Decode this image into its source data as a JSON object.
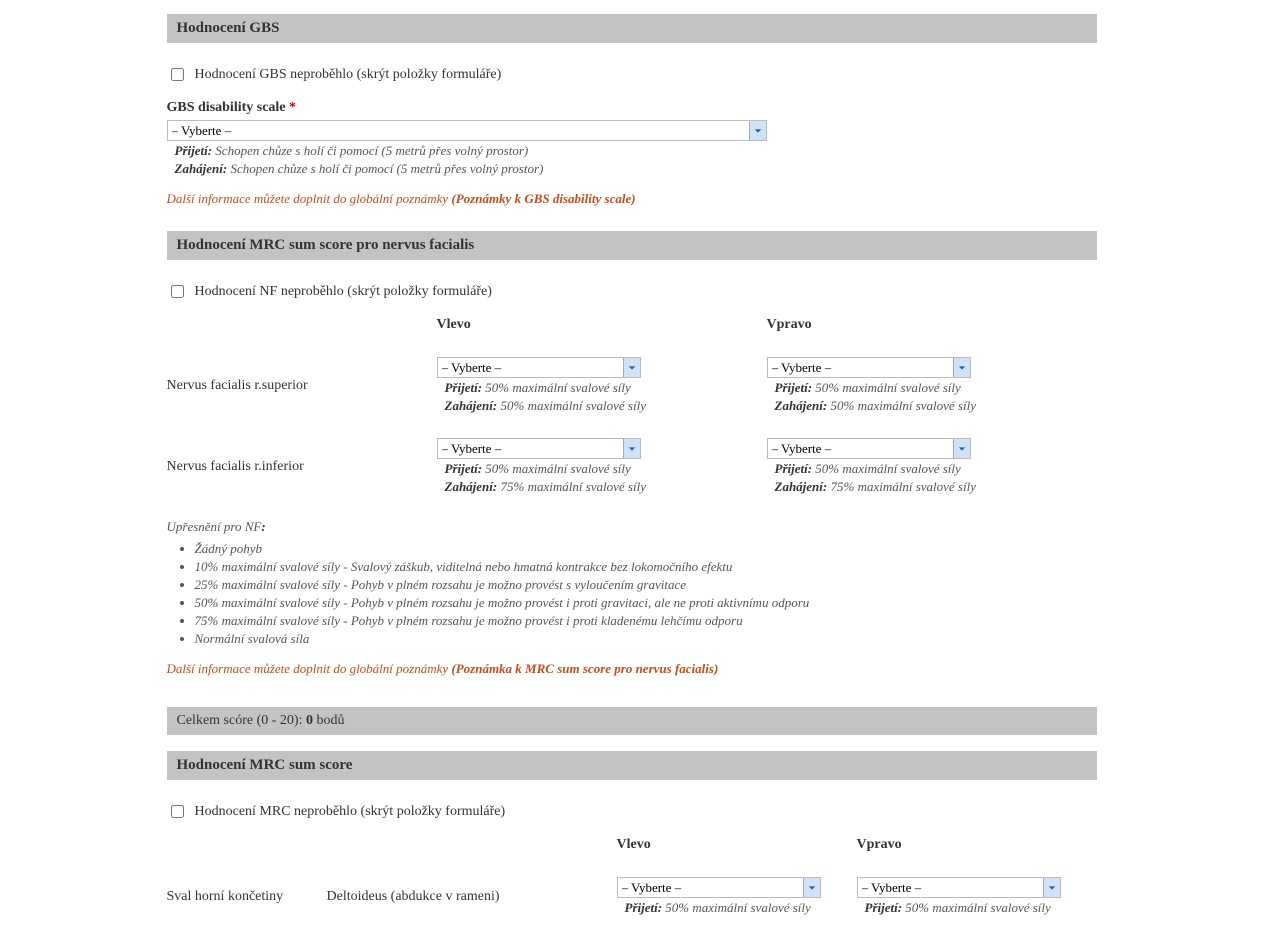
{
  "select_placeholder": "– Vyberte –",
  "hints": {
    "prijeti_label": "Přijetí:",
    "zahajeni_label": "Zahájení:"
  },
  "gbs": {
    "header": "Hodnocení GBS",
    "skip_label": "Hodnocení GBS neproběhlo (skrýt položky formuláře)",
    "scale_label": "GBS disability scale",
    "hint_prijeti": "Schopen chůze s holí či pomocí (5 metrů přes volný prostor)",
    "hint_zahajeni": "Schopen chůze s holí či pomocí (5 metrů přes volný prostor)",
    "note_prefix": "Další informace můžete doplnit do globální poznámky ",
    "note_bold": "(Poznámky k GBS disability scale)"
  },
  "nf": {
    "header": "Hodnocení MRC sum score pro nervus facialis",
    "skip_label": "Hodnocení NF neproběhlo (skrýt položky formuláře)",
    "col_left": "Vlevo",
    "col_right": "Vpravo",
    "rows": [
      {
        "label": "Nervus facialis r.superior",
        "left": {
          "prijeti": "50% maximální svalové síly",
          "zahajeni": "50% maximální svalové síly"
        },
        "right": {
          "prijeti": "50% maximální svalové síly",
          "zahajeni": "50% maximální svalové síly"
        }
      },
      {
        "label": "Nervus facialis r.inferior",
        "left": {
          "prijeti": "50% maximální svalové síly",
          "zahajeni": "75% maximální svalové síly"
        },
        "right": {
          "prijeti": "50% maximální svalové síly",
          "zahajeni": "75% maximální svalové síly"
        }
      }
    ],
    "upresneni_label": "Upřesnění pro NF",
    "bullets": [
      "Žádný pohyb",
      "10% maximální svalové síly - Svalový záškub, viditelná nebo hmatná kontrakce bez lokomočního efektu",
      "25% maximální svalové síly - Pohyb v plném rozsahu je možno provést s vyloučením gravitace",
      "50% maximální svalové síly - Pohyb v plném rozsahu je možno provést i proti gravitaci, ale ne proti aktivnímu odporu",
      "75% maximální svalové síly - Pohyb v plném rozsahu je možno provést i proti kladenému lehčímu odporu",
      "Normální svalová síla"
    ],
    "note_prefix": "Další informace můžete doplnit do globální poznámky ",
    "note_bold": "(Poznámka k MRC sum score pro nervus facialis)",
    "score_prefix": "Celkem scóre (0 - 20): ",
    "score_value": "0",
    "score_suffix": " bodů"
  },
  "mrc": {
    "header": "Hodnocení MRC sum score",
    "skip_label": "Hodnocení MRC neproběhlo (skrýt položky formuláře)",
    "col_left": "Vlevo",
    "col_right": "Vpravo",
    "group_label": "Sval horní končetiny",
    "rows": [
      {
        "label": "Deltoideus (abdukce v rameni)",
        "left": {
          "prijeti": "50% maximální svalové síly"
        },
        "right": {
          "prijeti": "50% maximální svalové síly"
        }
      }
    ]
  }
}
